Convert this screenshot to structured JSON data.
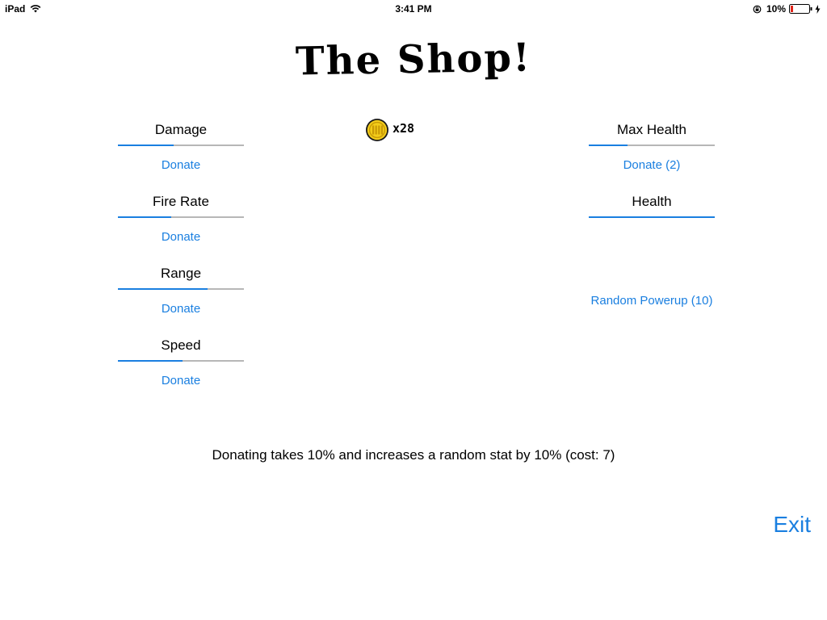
{
  "status_bar": {
    "device": "iPad",
    "time": "3:41 PM",
    "battery": "10%"
  },
  "title": "The Shop!",
  "coins": {
    "icon": "coin-icon",
    "count": "x28"
  },
  "stats_left": [
    {
      "label": "Damage",
      "progress": 0.44,
      "action": "Donate"
    },
    {
      "label": "Fire Rate",
      "progress": 0.42,
      "action": "Donate"
    },
    {
      "label": "Range",
      "progress": 0.71,
      "action": "Donate"
    },
    {
      "label": "Speed",
      "progress": 0.51,
      "action": "Donate"
    }
  ],
  "stats_right": [
    {
      "label": "Max Health",
      "progress": 0.31,
      "action": "Donate (2)"
    },
    {
      "label": "Health",
      "progress": 1.0
    }
  ],
  "random_powerup": "Random Powerup (10)",
  "info_text": "Donating takes 10% and increases a random stat by 10% (cost: 7)",
  "exit_label": "Exit",
  "colors": {
    "accent": "#1a7fe0",
    "track": "#b7b7b7",
    "battery_low": "#e0251b",
    "coin": "#f2cc1a"
  }
}
